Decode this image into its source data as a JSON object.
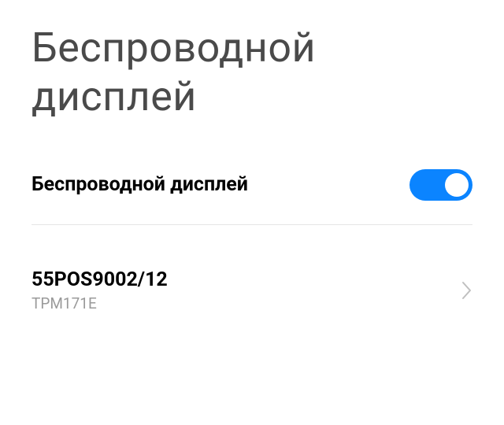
{
  "pageTitle": "Беспроводной дисплей",
  "toggle": {
    "label": "Беспроводной дисплей",
    "enabled": true
  },
  "device": {
    "name": "55POS9002/12",
    "subtitle": "TPM171E"
  }
}
